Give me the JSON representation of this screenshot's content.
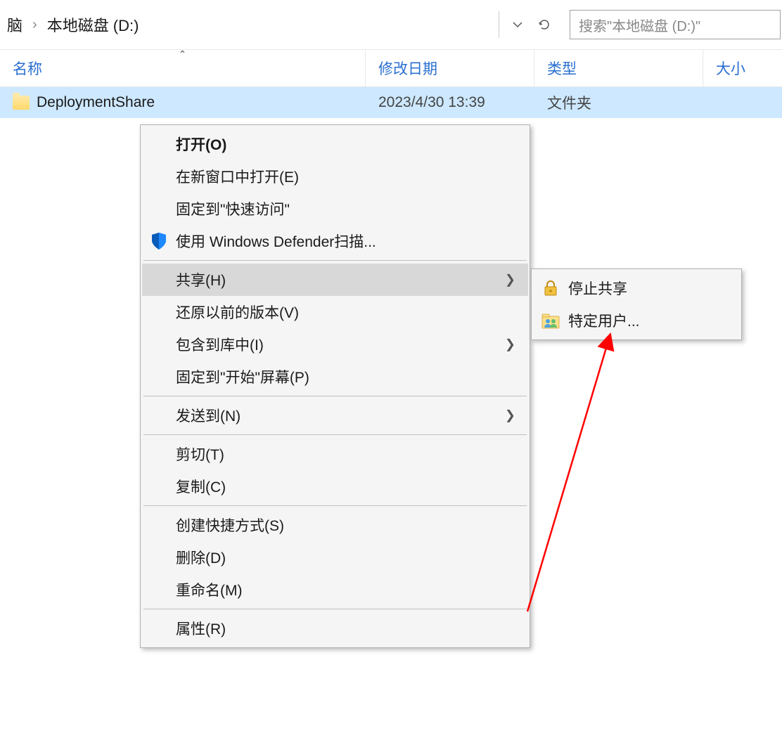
{
  "breadcrumb": {
    "parent_partial": "脑",
    "current": "本地磁盘 (D:)"
  },
  "search": {
    "placeholder": "搜索\"本地磁盘 (D:)\""
  },
  "columns": {
    "name": "名称",
    "date": "修改日期",
    "type": "类型",
    "size": "大小"
  },
  "files": [
    {
      "name": "DeploymentShare",
      "date": "2023/4/30 13:39",
      "type": "文件夹",
      "selected": true
    }
  ],
  "context_menu": {
    "open": "打开(O)",
    "open_new_window": "在新窗口中打开(E)",
    "pin_quick_access": "固定到\"快速访问\"",
    "defender_scan": "使用 Windows Defender扫描...",
    "share": "共享(H)",
    "restore_previous": "还原以前的版本(V)",
    "include_in_library": "包含到库中(I)",
    "pin_to_start": "固定到\"开始\"屏幕(P)",
    "send_to": "发送到(N)",
    "cut": "剪切(T)",
    "copy": "复制(C)",
    "create_shortcut": "创建快捷方式(S)",
    "delete": "删除(D)",
    "rename": "重命名(M)",
    "properties": "属性(R)"
  },
  "share_submenu": {
    "stop_sharing": "停止共享",
    "specific_people": "特定用户..."
  }
}
